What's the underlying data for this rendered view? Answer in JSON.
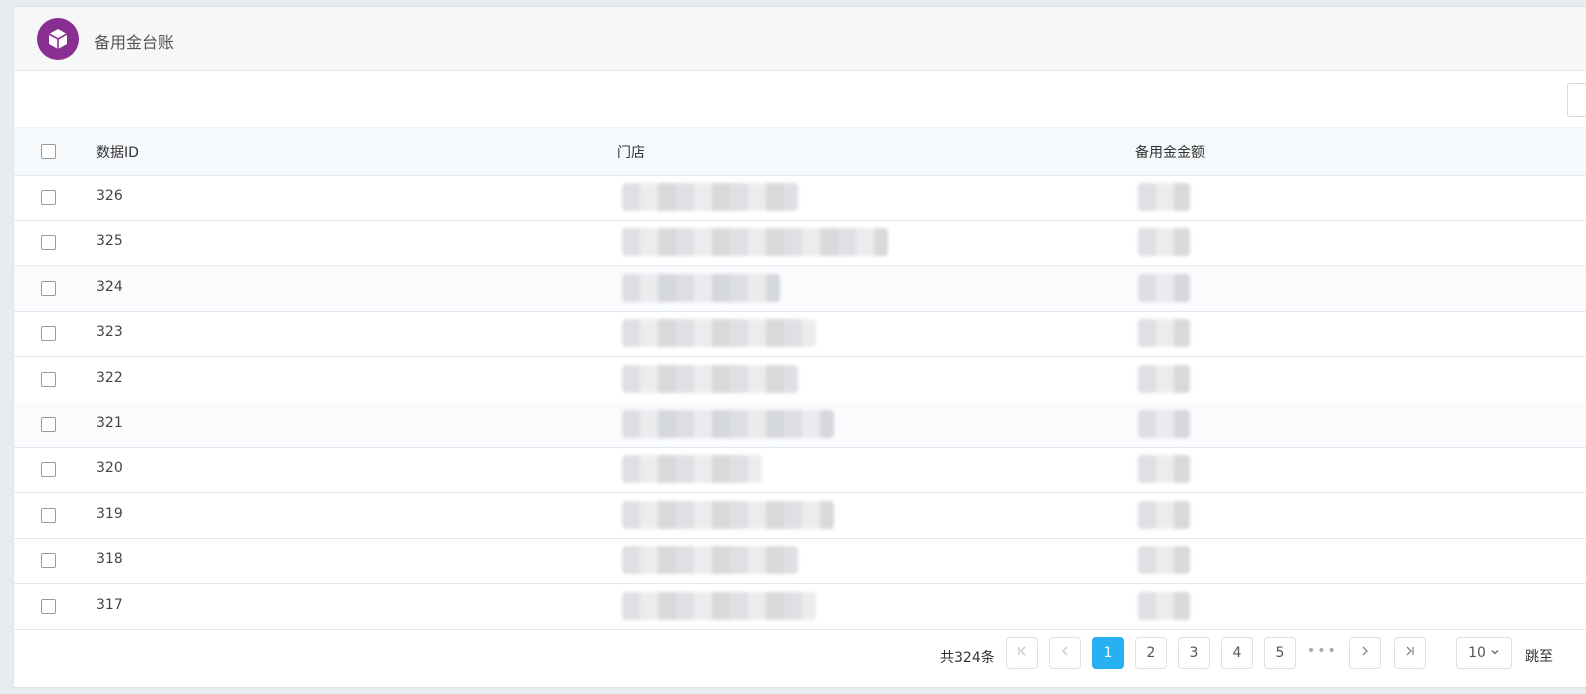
{
  "header": {
    "title": "备用金台账",
    "logo_icon": "cube-icon",
    "logo_color": "#8a2f92"
  },
  "table": {
    "columns": [
      "数据ID",
      "门店",
      "备用金金额"
    ],
    "rows": [
      {
        "id": "326"
      },
      {
        "id": "325"
      },
      {
        "id": "324"
      },
      {
        "id": "323"
      },
      {
        "id": "322"
      },
      {
        "id": "321"
      },
      {
        "id": "320"
      },
      {
        "id": "319"
      },
      {
        "id": "318"
      },
      {
        "id": "317"
      }
    ]
  },
  "pagination": {
    "total": "共324条",
    "pages": [
      "1",
      "2",
      "3",
      "4",
      "5"
    ],
    "current": "1",
    "ellipsis": "•••",
    "page_size": "10",
    "jump_label": "跳至",
    "first_icon": "first-page-icon",
    "prev_icon": "chevron-left-icon",
    "next_icon": "chevron-right-icon",
    "last_icon": "last-page-icon",
    "accent": "#27b0f2"
  }
}
